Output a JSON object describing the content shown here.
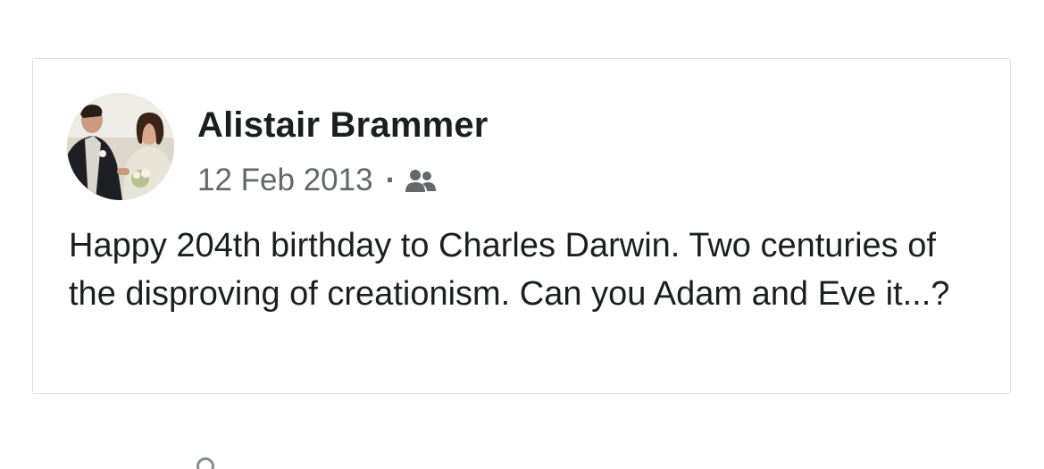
{
  "post": {
    "author_name": "Alistair Brammer",
    "date": "12 Feb 2013",
    "separator": "·",
    "audience_icon": "friends-icon",
    "text": "Happy 204th birthday to Charles Darwin. Two centuries of the disproving of creationism. Can you Adam and Eve it...?"
  },
  "colors": {
    "text_primary": "#1c1e21",
    "text_secondary": "#65676b",
    "card_border": "#dddfe2"
  }
}
